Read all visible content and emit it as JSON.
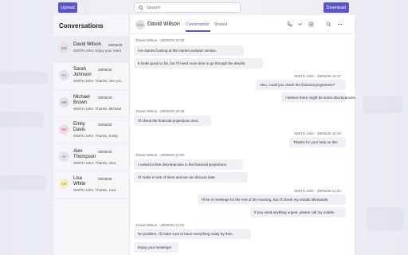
{
  "toolbar": {
    "upload_label": "Upload",
    "download_label": "Download",
    "search_placeholder": "Search"
  },
  "sidebar": {
    "title": "Conversations",
    "items": [
      {
        "initials": "DW",
        "name_line1": "David Wilson",
        "name_line2": "",
        "date": "29/06/25",
        "preview": "SMITH John: Enjoy your meet",
        "avatar_color": "#e9dfe6",
        "active": true
      },
      {
        "initials": "SJ",
        "name_line1": "Sarah",
        "name_line2": "Johnson",
        "date": "29/06/25",
        "preview": "SMITH John: Thanks, see you",
        "avatar_color": "#dfe2ee",
        "active": false
      },
      {
        "initials": "MB",
        "name_line1": "Michael",
        "name_line2": "Brown",
        "date": "29/06/25",
        "preview": "SMITH John: Thanks, Michael",
        "avatar_color": "#e5def0",
        "active": false
      },
      {
        "initials": "ED",
        "name_line1": "Emily",
        "name_line2": "Davis",
        "date": "29/06/25",
        "preview": "SMITH John: Thanks, Emily.",
        "avatar_color": "#f3dde3",
        "active": false
      },
      {
        "initials": "AT",
        "name_line1": "Alex",
        "name_line2": "Thompson",
        "date": "29/06/25",
        "preview": "SMITH John: Thanks, Alex.",
        "avatar_color": "#e6e3ec",
        "active": false
      },
      {
        "initials": "LW",
        "name_line1": "Lisa",
        "name_line2": "White",
        "date": "29/06/25",
        "preview": "SMITH John: Thanks, Lisa.",
        "avatar_color": "#f5eec6",
        "active": false
      }
    ]
  },
  "chat": {
    "initials": "DW",
    "contact_name": "David Wilson",
    "tabs": [
      "Conversation",
      "Shared"
    ],
    "messages": [
      {
        "sender": "David Wilson - 29/06/25 10:36",
        "text": "I've started looking at the market analysis section."
      },
      {
        "sender": "",
        "text": "It looks good so far, but I'll need more time to go through the details."
      },
      {
        "sender": "SMITH John - 29/06/25 10:37",
        "text": "Also, could you check the financial projections?"
      },
      {
        "sender": "",
        "text": "I believe there might be some discrepancies."
      },
      {
        "sender": "David Wilson - 29/06/25 10:39",
        "text": "I'll check the financial projections next."
      },
      {
        "sender": "SMITH John - 29/06/25 10:40",
        "text": "Thanks for your help on this."
      },
      {
        "sender": "David Wilson - 29/06/25 11:00",
        "text": "I noticed a few discrepancies in the financial projections."
      },
      {
        "sender": "",
        "text": "I'll make a note of them and we can discuss later."
      },
      {
        "sender": "SMITH John - 29/06/25 11:02",
        "text": "I'll be in meetings for the rest of the morning, but I'll check my emails afterwards."
      },
      {
        "sender": "",
        "text": "If you need anything urgent, please call my mobile."
      },
      {
        "sender": "David Wilson - 29/06/25 11:04",
        "text": "No problem, I'll make sure to have everything ready by then."
      },
      {
        "sender": "",
        "text": "Enjoy your meetings!"
      }
    ]
  },
  "colors": {
    "accent": "#5b55c9",
    "panel": "#ffffff",
    "bubble": "#f0f0f4"
  }
}
